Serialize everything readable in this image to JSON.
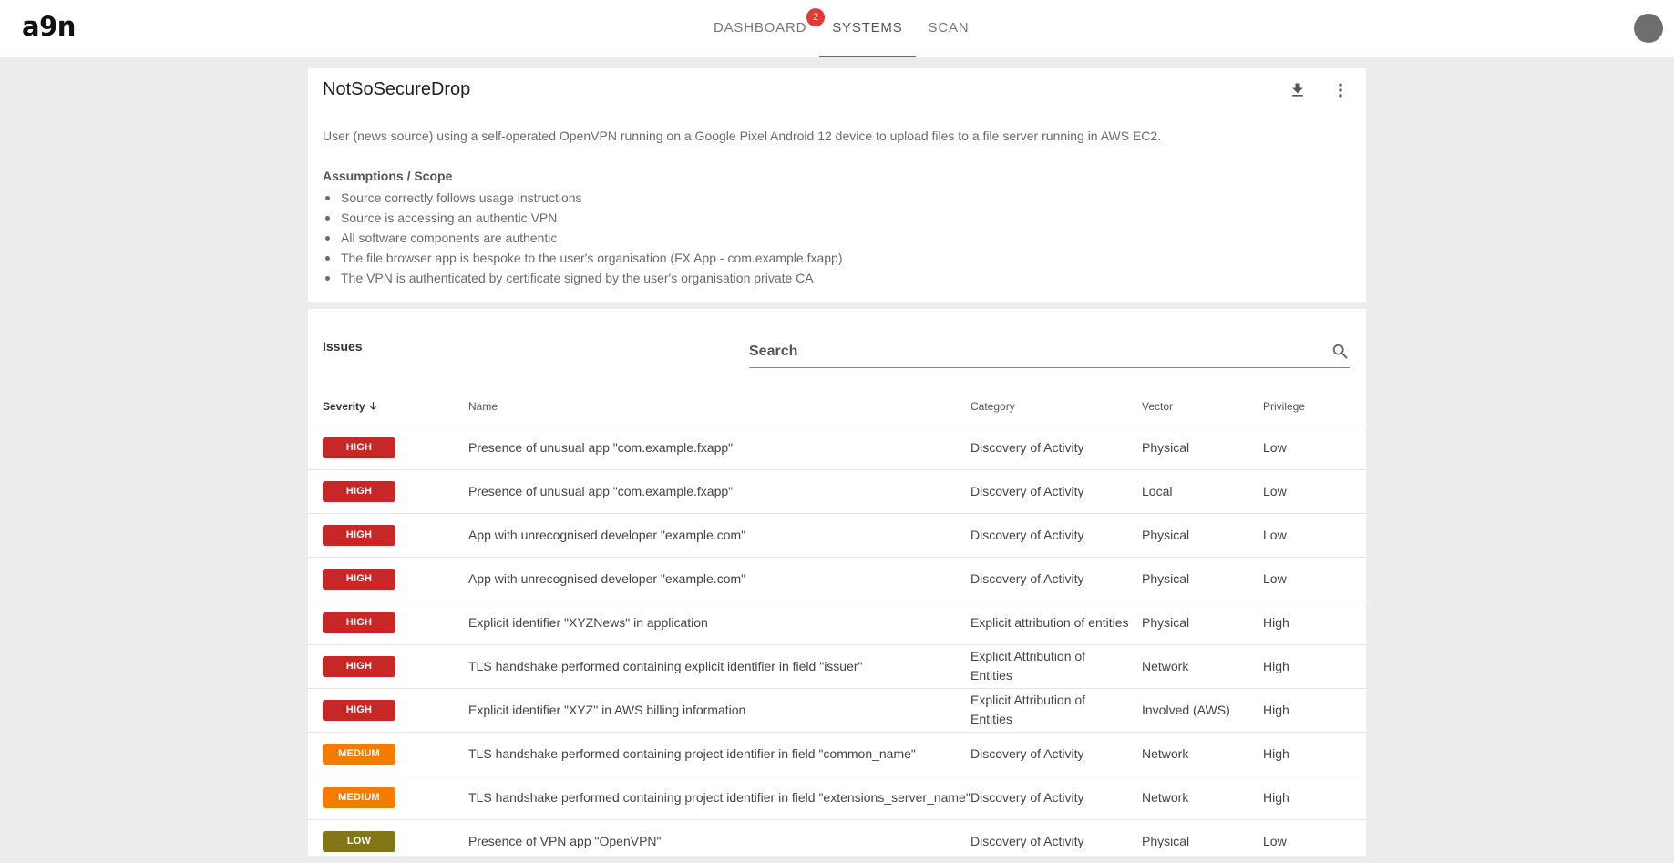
{
  "app": {
    "logo": "a9n"
  },
  "nav": {
    "tabs": [
      {
        "label": "DASHBOARD",
        "badge": "2"
      },
      {
        "label": "SYSTEMS",
        "active": true
      },
      {
        "label": "SCAN"
      }
    ]
  },
  "system": {
    "title": "NotSoSecureDrop",
    "description": "User (news source) using a self-operated OpenVPN running on a Google Pixel Android 12 device to upload files to a file server running in AWS EC2.",
    "scope_heading": "Assumptions / Scope",
    "scope_items": [
      "Source correctly follows usage instructions",
      "Source is accessing an authentic VPN",
      "All software components are authentic",
      "The file browser app is bespoke to the user's organisation (FX App - com.example.fxapp)",
      "The VPN is authenticated by certificate signed by the user's organisation private CA"
    ],
    "icons": [
      "download-icon",
      "more-vert-icon"
    ]
  },
  "issues": {
    "title": "Issues",
    "search_placeholder": "Search",
    "columns": {
      "severity": "Severity",
      "name": "Name",
      "category": "Category",
      "vector": "Vector",
      "privilege": "Privilege"
    },
    "severity_colors": {
      "HIGH": "#c62828",
      "MEDIUM": "#f57c00",
      "LOW": "#827717"
    },
    "rows": [
      {
        "severity": "HIGH",
        "name": "Presence of unusual app \"com.example.fxapp\"",
        "category": "Discovery of Activity",
        "vector": "Physical",
        "privilege": "Low"
      },
      {
        "severity": "HIGH",
        "name": "Presence of unusual app \"com.example.fxapp\"",
        "category": "Discovery of Activity",
        "vector": "Local",
        "privilege": "Low"
      },
      {
        "severity": "HIGH",
        "name": "App with unrecognised developer \"example.com\"",
        "category": "Discovery of Activity",
        "vector": "Physical",
        "privilege": "Low"
      },
      {
        "severity": "HIGH",
        "name": "App with unrecognised developer \"example.com\"",
        "category": "Discovery of Activity",
        "vector": "Physical",
        "privilege": "Low"
      },
      {
        "severity": "HIGH",
        "name": "Explicit identifier \"XYZNews\" in application",
        "category": "Explicit attribution of entities",
        "vector": "Physical",
        "privilege": "High"
      },
      {
        "severity": "HIGH",
        "name": "TLS handshake performed containing explicit identifier in field \"issuer\"",
        "category": "Explicit Attribution of Entities",
        "vector": "Network",
        "privilege": "High"
      },
      {
        "severity": "HIGH",
        "name": "Explicit identifier \"XYZ\" in AWS billing information",
        "category": "Explicit Attribution of Entities",
        "vector": "Involved (AWS)",
        "privilege": "High"
      },
      {
        "severity": "MEDIUM",
        "name": "TLS handshake performed containing project identifier in field \"common_name\"",
        "category": "Discovery of Activity",
        "vector": "Network",
        "privilege": "High"
      },
      {
        "severity": "MEDIUM",
        "name": "TLS handshake performed containing project identifier in field \"extensions_server_name\"",
        "category": "Discovery of Activity",
        "vector": "Network",
        "privilege": "High"
      },
      {
        "severity": "LOW",
        "name": "Presence of VPN app \"OpenVPN\"",
        "category": "Discovery of Activity",
        "vector": "Physical",
        "privilege": "Low"
      }
    ]
  }
}
